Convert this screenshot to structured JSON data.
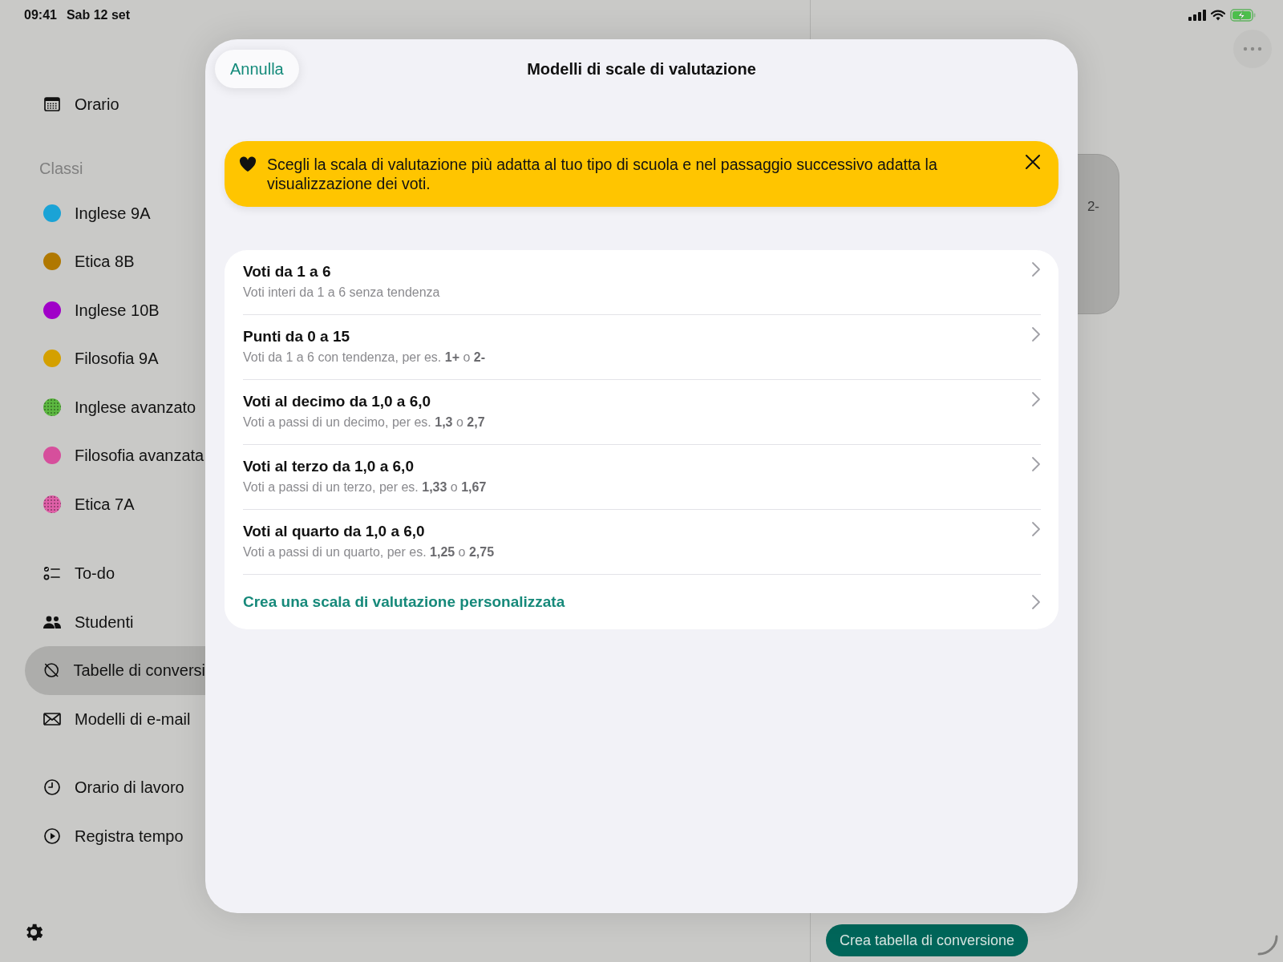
{
  "status_bar": {
    "time": "09:41",
    "date": "Sab 12 set"
  },
  "sidebar": {
    "sections": [
      {
        "items": [
          {
            "label": "Orario",
            "selected": false
          }
        ]
      },
      {
        "title": "Classi",
        "items": [
          {
            "label": "Inglese 9A",
            "selected": false,
            "color": "#1aa3d6",
            "patterned": false
          },
          {
            "label": "Etica 8B",
            "selected": false,
            "color": "#b07800",
            "patterned": false
          },
          {
            "label": "Inglese 10B",
            "selected": false,
            "color": "#a000c8",
            "patterned": false
          },
          {
            "label": "Filosofia 9A",
            "selected": false,
            "color": "#d4a000",
            "patterned": false
          },
          {
            "label": "Inglese avanzato",
            "selected": false,
            "color": "#5cb840",
            "patterned": true
          },
          {
            "label": "Filosofia avanzata",
            "selected": false,
            "color": "#d64f9c",
            "patterned": false
          },
          {
            "label": "Etica 7A",
            "selected": false,
            "color": "#e060a8",
            "patterned": true
          }
        ]
      },
      {
        "items": [
          {
            "label": "To-do",
            "selected": false
          },
          {
            "label": "Studenti",
            "selected": false
          },
          {
            "label": "Tabelle di conversi",
            "selected": true
          },
          {
            "label": "Modelli di e-mail",
            "selected": false
          }
        ]
      },
      {
        "items": [
          {
            "label": "Orario di lavoro",
            "selected": false
          },
          {
            "label": "Registra tempo",
            "selected": false
          }
        ]
      }
    ]
  },
  "detail": {
    "card_text": "2-",
    "button": "Crea tabella di conversione"
  },
  "modal": {
    "cancel": "Annulla",
    "title": "Modelli di scale di valutazione",
    "banner": "Scegli la scala di valutazione più adatta al tuo tipo di scuola e nel passaggio successivo adatta la visualizzazione dei voti.",
    "options": [
      {
        "kind": "scale",
        "title": "Voti da 1 a 6",
        "subtitle": "Voti interi da 1 a 6 senza tendenza"
      },
      {
        "kind": "scale",
        "title": "Punti da 0 a 15",
        "subtitle": "Voti da 1 a 6 con tendenza, per es. **1+** o **2-**"
      },
      {
        "kind": "scale",
        "title": "Voti al decimo da 1,0 a 6,0",
        "subtitle": "Voti a passi di un decimo, per es. **1,3** o **2,7**"
      },
      {
        "kind": "scale",
        "title": "Voti al terzo da 1,0 a 6,0",
        "subtitle": "Voti a passi di un terzo, per es. **1,33** o **1,67**"
      },
      {
        "kind": "scale",
        "title": "Voti al quarto da 1,0 a 6,0",
        "subtitle": "Voti a passi di un quarto, per es. **1,25** o **2,75**"
      },
      {
        "kind": "action",
        "title": "Crea una scala di valutazione personalizzata"
      }
    ]
  }
}
